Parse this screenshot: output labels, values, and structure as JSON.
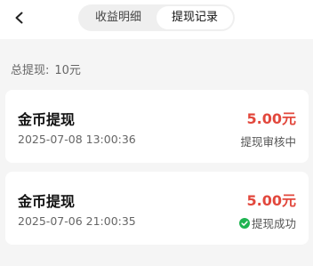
{
  "header": {
    "tabs": [
      {
        "label": "收益明细",
        "active": false
      },
      {
        "label": "提现记录",
        "active": true
      }
    ]
  },
  "summary": {
    "label": "总提现:",
    "value": "10元"
  },
  "records": [
    {
      "title": "金币提现",
      "datetime": "2025-07-08 13:00:36",
      "amount": "5.00元",
      "status": "提现审核中",
      "status_icon": "none"
    },
    {
      "title": "金币提现",
      "datetime": "2025-07-06 21:00:35",
      "amount": "5.00元",
      "status": "提现成功",
      "status_icon": "success-check-icon"
    }
  ],
  "colors": {
    "amount": "#e2483d",
    "success": "#1fb451",
    "background": "#f5f5f5"
  }
}
